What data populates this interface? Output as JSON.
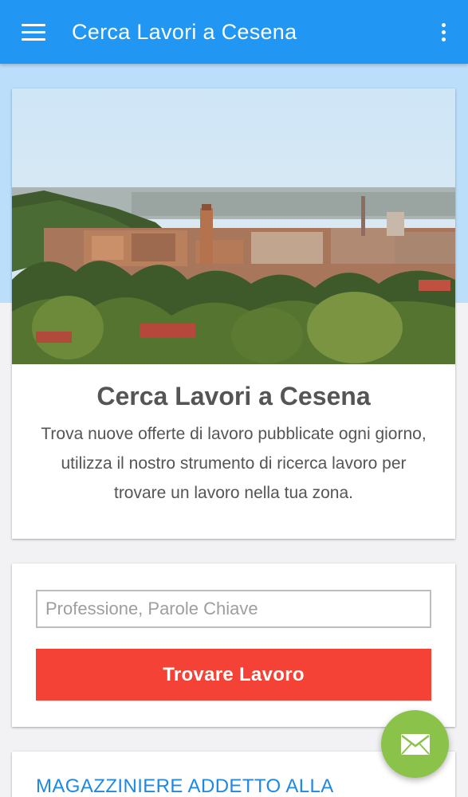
{
  "app_bar": {
    "title": "Cerca Lavori a Cesena",
    "menu_icon": "hamburger-menu-icon",
    "overflow_icon": "more-vert-icon",
    "background": "#2196f3"
  },
  "hero": {
    "image": "cesena-city-panorama",
    "title": "Cerca Lavori a Cesena",
    "description": "Trova nuove offerte di lavoro pubblicate ogni giorno, utilizza il nostro strumento di ricerca lavoro per trovare un lavoro nella tua zona."
  },
  "search": {
    "placeholder": "Professione, Parole Chiave",
    "value": "",
    "button_label": "Trovare Lavoro",
    "button_color": "#f44336"
  },
  "job_listing": {
    "title": "MAGAZZINIERE ADDETTO ALLA",
    "link_color": "#1e88e5"
  },
  "fab": {
    "icon": "mail-icon",
    "color": "#8bc34a"
  }
}
